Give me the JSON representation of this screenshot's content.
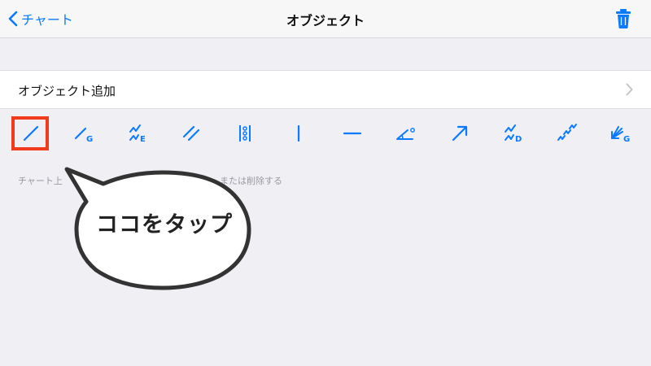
{
  "nav": {
    "back_label": "チャート",
    "title": "オブジェクト"
  },
  "add_object": {
    "label": "オブジェクト追加"
  },
  "toolbar": {
    "tools": [
      {
        "icon": "trendline-icon"
      },
      {
        "icon": "trendline-g-icon"
      },
      {
        "icon": "elliott-wave-icon"
      },
      {
        "icon": "parallel-lines-icon"
      },
      {
        "icon": "fibonacci-icon"
      },
      {
        "icon": "vertical-line-icon"
      },
      {
        "icon": "horizontal-line-icon"
      },
      {
        "icon": "angle-icon"
      },
      {
        "icon": "arrow-icon"
      },
      {
        "icon": "elliott-wave-d-icon"
      },
      {
        "icon": "zigzag-icon"
      },
      {
        "icon": "gann-fan-icon"
      }
    ]
  },
  "hint": {
    "text_start": "チャート上",
    "text_end": "または削除する"
  },
  "callout": {
    "text": "ココをタップ"
  },
  "colors": {
    "accent": "#0a7aff",
    "highlight": "#f23a1c",
    "background": "#efeff4"
  }
}
